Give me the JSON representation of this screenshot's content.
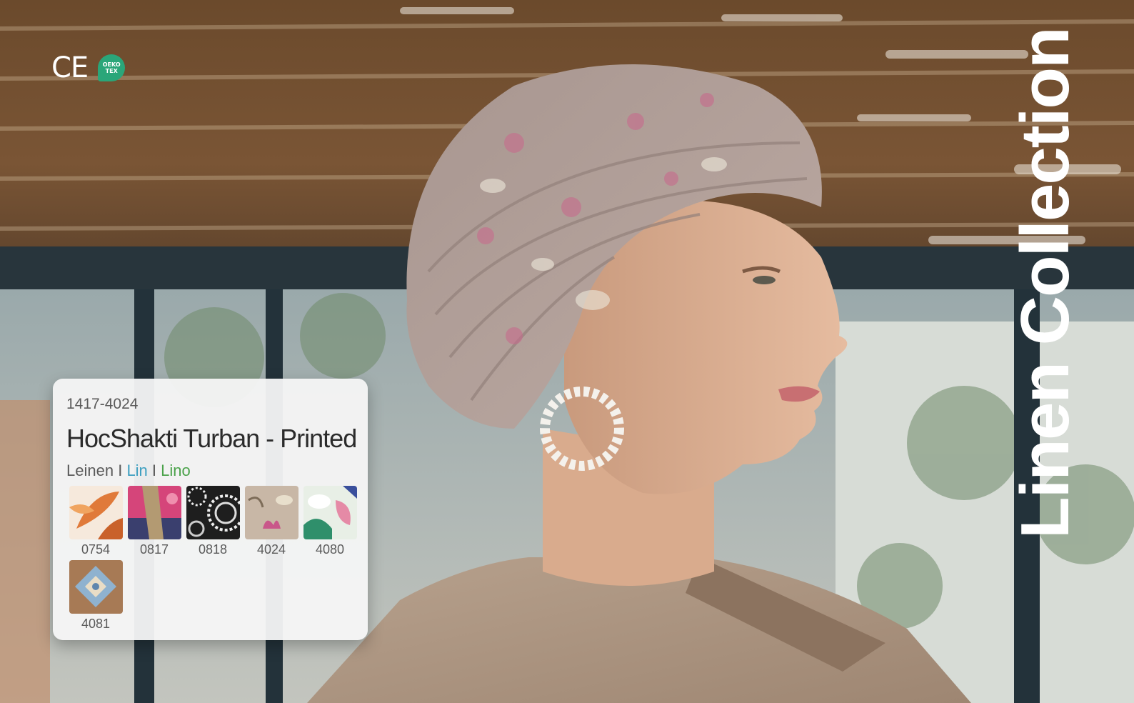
{
  "certifications": {
    "ce_label": "CE",
    "oeko_label_line1": "OEKO",
    "oeko_label_line2": "TEX",
    "oeko_color": "#2aa679"
  },
  "collection_title": "Linen Collection",
  "product": {
    "article_number": "1417-4024",
    "name": "HocShakti Turban - Printed",
    "material": {
      "de": "Leinen",
      "separator": "I",
      "fr": "Lin",
      "it": "Lino",
      "fr_color": "#3d9fc0",
      "it_color": "#4aa24a"
    },
    "swatches": [
      {
        "code": "0754",
        "pattern": "orange-leaf-print"
      },
      {
        "code": "0817",
        "pattern": "pink-tree-bark-print"
      },
      {
        "code": "0818",
        "pattern": "black-white-mandala-print"
      },
      {
        "code": "4024",
        "pattern": "beige-floral-print"
      },
      {
        "code": "4080",
        "pattern": "green-pink-floral-print"
      },
      {
        "code": "4081",
        "pattern": "blue-tile-print"
      }
    ]
  }
}
